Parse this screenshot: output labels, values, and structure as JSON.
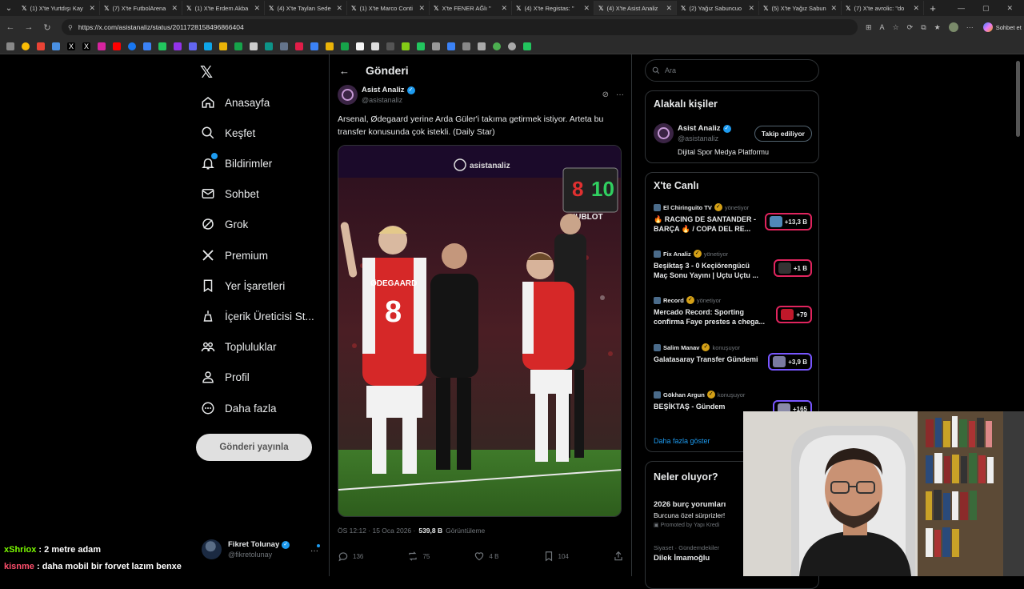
{
  "browser": {
    "tabs": [
      {
        "label": "(1) X'te Yurtdışı Kay",
        "active": false
      },
      {
        "label": "(7) X'te FutbolArena",
        "active": false
      },
      {
        "label": "(1) X'te Erdem Akba",
        "active": false
      },
      {
        "label": "(4) X'te Taylan Sede",
        "active": false
      },
      {
        "label": "(1) X'te Marco Conti",
        "active": false
      },
      {
        "label": "X'te FENER AĞlı \"",
        "active": false
      },
      {
        "label": "(4) X'te Registas: \"",
        "active": false
      },
      {
        "label": "(4) X'te Asist Analiz",
        "active": true
      },
      {
        "label": "(2) Yağız Sabuncuo",
        "active": false
      },
      {
        "label": "(5) X'te Yağız Sabun",
        "active": false
      },
      {
        "label": "(7) X'te avrolic: \"do",
        "active": false
      }
    ],
    "url": "https://x.com/asistanaliz/status/2011728158496866404",
    "copilot_label": "Sohbet et"
  },
  "nav": {
    "items": [
      {
        "label": "Anasayfa",
        "icon": "home-icon"
      },
      {
        "label": "Keşfet",
        "icon": "search-icon"
      },
      {
        "label": "Bildirimler",
        "icon": "bell-icon"
      },
      {
        "label": "Sohbet",
        "icon": "mail-icon"
      },
      {
        "label": "Grok",
        "icon": "grok-icon"
      },
      {
        "label": "Premium",
        "icon": "x-premium-icon"
      },
      {
        "label": "Yer İşaretleri",
        "icon": "bookmark-icon"
      },
      {
        "label": "İçerik Üreticisi St...",
        "icon": "creator-studio-icon"
      },
      {
        "label": "Topluluklar",
        "icon": "communities-icon"
      },
      {
        "label": "Profil",
        "icon": "profile-icon"
      },
      {
        "label": "Daha fazla",
        "icon": "more-icon"
      }
    ],
    "post_button": "Gönderi yayınla",
    "account": {
      "name": "Fikret Tolunay",
      "handle": "@fikretolunay"
    }
  },
  "post": {
    "header_title": "Gönderi",
    "author_name": "Asist Analiz",
    "author_handle": "@asistanaliz",
    "text": "Arsenal, Ødegaard yerine Arda Güler'i takıma getirmek istiyor. Arteta bu transfer konusunda çok istekli. (Daily Star)",
    "image_watermark": "asistanaliz",
    "board_number": "8",
    "board_number2": "10",
    "board_brand": "HUBLOT",
    "shirt_name": "ØDEGAARD",
    "shirt_number": "8",
    "time": "ÖS 12:12 · 15 Oca 2026 ·",
    "views_count": "539,8 B",
    "views_label": "Görüntüleme",
    "replies": "136",
    "reposts": "75",
    "likes": "4 B",
    "bookmarks": "104"
  },
  "sidebar": {
    "search_placeholder": "Ara",
    "related": {
      "title": "Alakalı kişiler",
      "name": "Asist Analiz",
      "handle": "@asistanaliz",
      "follow_label": "Takip ediliyor",
      "bio": "Dijital Spor Medya Platformu"
    },
    "live": {
      "title": "X'te Canlı",
      "items": [
        {
          "host": "El Chiringuito TV",
          "role": "yönetiyor",
          "title": "🔥 RACING DE SANTANDER - BARÇA 🔥 / COPA DEL RE...",
          "count": "+13,3 B",
          "border": "#e0245e"
        },
        {
          "host": "Fix Analiz",
          "role": "yönetiyor",
          "title": "Beşiktaş 3 - 0 Keçiörengücü Maç Sonu Yayını | Uçtu Uçtu ...",
          "count": "+1 B",
          "border": "#e0245e"
        },
        {
          "host": "Record",
          "role": "yönetiyor",
          "title": "Mercado Record: Sporting confirma Faye prestes a chega...",
          "count": "+79",
          "border": "#e0245e"
        },
        {
          "host": "Salim Manav",
          "role": "konuşuyor",
          "title": "Galatasaray Transfer Gündemi",
          "count": "+3,9 B",
          "border": "#7856ff"
        },
        {
          "host": "Gökhan Argun",
          "role": "konuşuyor",
          "title": "BEŞİKTAŞ - Gündem",
          "count": "+165",
          "border": "#7856ff"
        }
      ],
      "more_label": "Daha fazla göster"
    },
    "trends": {
      "title": "Neler oluyor?",
      "items": [
        {
          "meta": "",
          "title": "2026 burç yorumları",
          "sub": "Burcuna özel sürprizler!",
          "promo": "Promoted by Yapı Kredi"
        },
        {
          "meta": "Siyaset · Gündemdekiler",
          "title": "Dilek İmamoğlu",
          "sub": "",
          "promo": ""
        }
      ]
    }
  },
  "chat": [
    {
      "user": "xShriox",
      "message": ": 2 metre adam",
      "color": "#7cfc00"
    },
    {
      "user": "kisnme",
      "message": ": daha mobil bir forvet lazım benxe",
      "color": "#ff4f6d"
    }
  ]
}
